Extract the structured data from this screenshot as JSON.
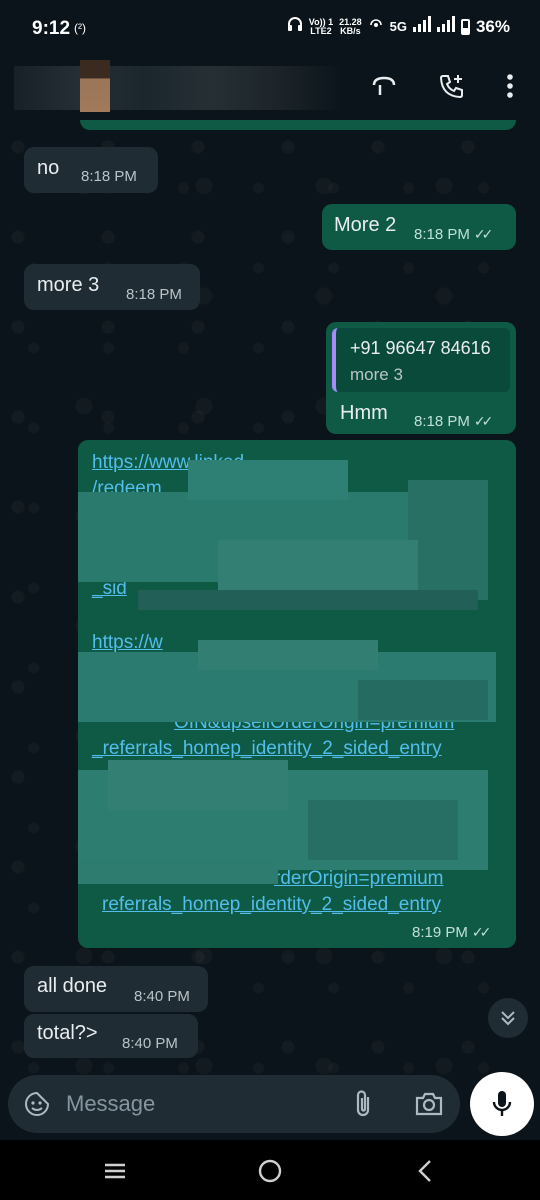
{
  "status_bar": {
    "time": "9:12",
    "hotspot": "(²)",
    "volte_top": "Vo)) 1",
    "volte_bottom": "LTE2",
    "speed_top": "21.28",
    "speed_bottom": "KB/s",
    "network": "5G",
    "battery": "36%"
  },
  "header": {
    "icons": [
      "voice-chat-icon",
      "add-call-icon",
      "more-vert-icon"
    ]
  },
  "messages": [
    {
      "dir": "in",
      "text": "no",
      "time": "8:18 PM"
    },
    {
      "dir": "out",
      "text": "More 2",
      "time": "8:18 PM",
      "ticks": "✓✓"
    },
    {
      "dir": "in",
      "text": "more 3",
      "time": "8:18 PM"
    },
    {
      "dir": "out",
      "quote_phone": "+91 96647 84616",
      "quote_text": "more 3",
      "text": "Hmm",
      "time": "8:18 PM",
      "ticks": "✓✓"
    },
    {
      "dir": "out",
      "link1_line1": "https://www.linked",
      "link1_line2": "/redeem",
      "link1_frag": "_sid",
      "link2_line1": "https://w",
      "link2_line2": "OIN&upsellOrderOrigin=premium",
      "link2_line3": "_referrals_homep_identity_2_sided_entry",
      "link3_line1": "rderOrigin=premium",
      "link3_line2": "referrals_homep_identity_2_sided_entry",
      "time": "8:19 PM",
      "ticks": "✓✓"
    },
    {
      "dir": "in",
      "text": "all done",
      "time": "8:40 PM"
    },
    {
      "dir": "in",
      "text": "total?>",
      "time": "8:40 PM"
    }
  ],
  "composer": {
    "placeholder": "Message"
  },
  "colors": {
    "incoming": "#202c33",
    "outgoing": "#0f5a45",
    "link": "#53bdeb",
    "background": "#0b141a"
  }
}
